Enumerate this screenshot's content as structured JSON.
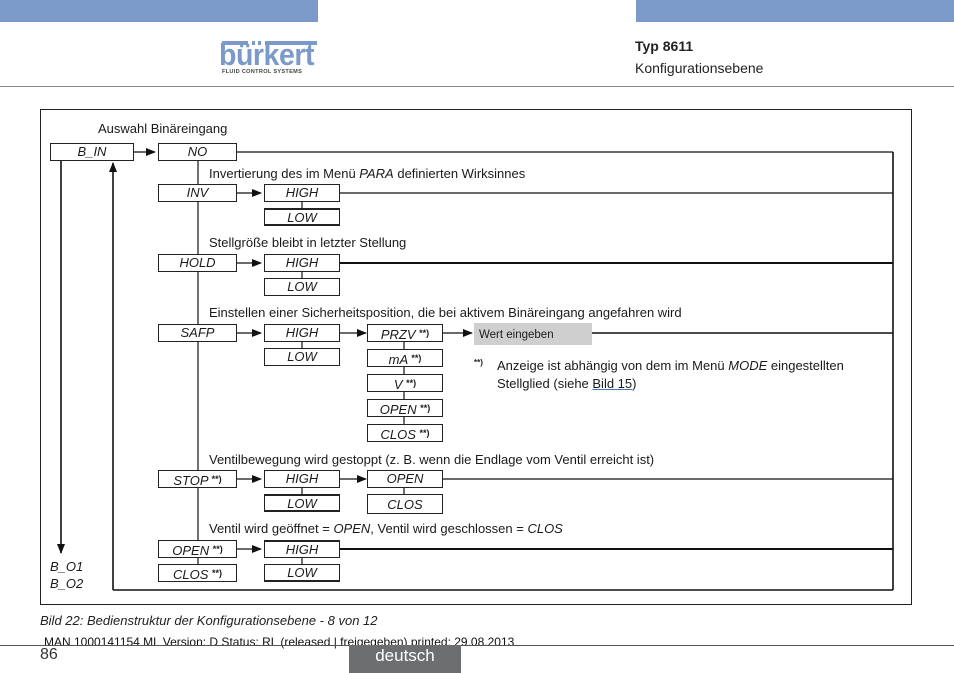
{
  "header": {
    "brand": "bürkert",
    "brand_sub": "FLUID CONTROL SYSTEMS",
    "title": "Typ 8611",
    "subtitle": "Konfigurationsebene",
    "accent_color": "#7b9ac9"
  },
  "diagram": {
    "heading": "Auswahl Binäreingang",
    "root": "B_IN",
    "outputs": [
      "B_O1",
      "B_O2"
    ],
    "footnote_marker": "**)",
    "rows": {
      "no": {
        "label": "NO"
      },
      "inv": {
        "label": "INV",
        "desc_pre": "Invertierung des im Menü ",
        "desc_em": "PARA",
        "desc_post": " definierten Wirksinnes",
        "options": [
          "HIGH",
          "LOW"
        ]
      },
      "hold": {
        "label": "HOLD",
        "desc": "Stellgröße bleibt in letzter Stellung",
        "options": [
          "HIGH",
          "LOW"
        ]
      },
      "safp": {
        "label": "SAFP",
        "desc": "Einstellen einer Sicherheitsposition, die bei aktivem Binäreingang angefahren wird",
        "options": [
          "HIGH",
          "LOW"
        ],
        "sub_options": [
          "PRZV",
          "mA",
          "V",
          "OPEN",
          "CLOS"
        ],
        "input_label": "Wert eingeben"
      },
      "stop": {
        "label": "STOP",
        "desc": "Ventilbewegung wird gestoppt (z. B. wenn die Endlage vom Ventil erreicht ist)",
        "options": [
          "HIGH",
          "LOW"
        ],
        "sub_options": [
          "OPEN",
          "CLOS"
        ]
      },
      "openclos": {
        "labels": [
          "OPEN",
          "CLOS"
        ],
        "desc_pre": "Ventil wird geöffnet = ",
        "desc_em1": "OPEN",
        "desc_mid": ", Ventil wird geschlossen = ",
        "desc_em2": "CLOS",
        "options": [
          "HIGH",
          "LOW"
        ]
      }
    },
    "footnote": {
      "line1_pre": "Anzeige ist abhängig von dem im Menü ",
      "line1_em": "MODE",
      "line1_post": " eingestellten",
      "line2_pre": "Stellglied (siehe ",
      "line2_link": "Bild 15",
      "line2_post": ")"
    }
  },
  "caption": "Bild 22:  Bedienstruktur der Konfigurationsebene - 8 von 12",
  "footer": {
    "doc_info": "MAN  1000141154  ML  Version: D Status: RL (released | freigegeben)  printed: 29.08.2013",
    "page_number": "86",
    "language": "deutsch"
  }
}
